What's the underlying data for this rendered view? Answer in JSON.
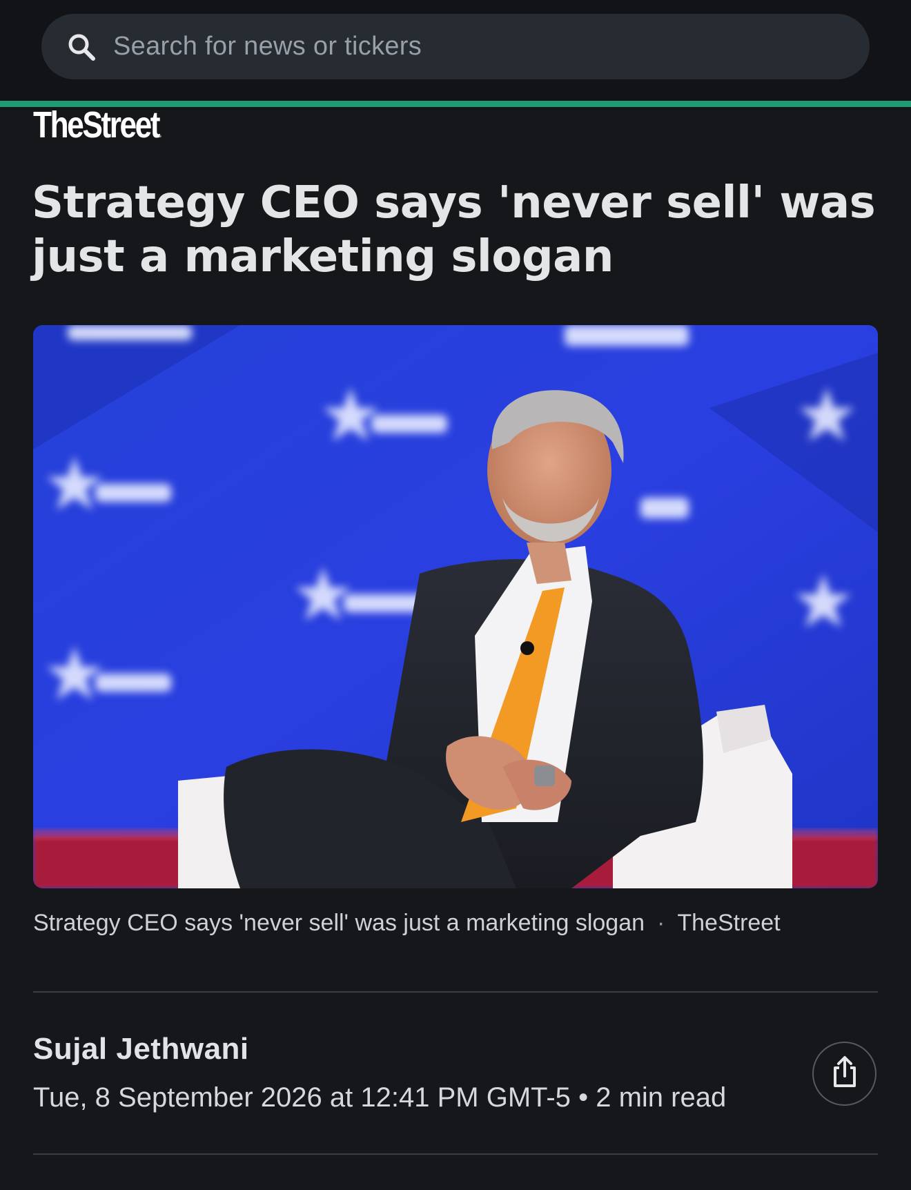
{
  "search": {
    "placeholder": "Search for news or tickers"
  },
  "publisher": {
    "logo_text": "TheStreet"
  },
  "article": {
    "headline": "Strategy CEO says 'never sell' was just a marketing slogan",
    "image_caption": "Strategy CEO says 'never sell' was just a marketing slogan",
    "image_source": "TheStreet",
    "caption_separator": "·",
    "author": "Sujal Jethwani",
    "date": "Tue, 8 September 2026 at 12:41 PM GMT-5",
    "meta_separator": "•",
    "read_time": "2 min read"
  },
  "icons": {
    "search": "search-icon",
    "share": "share-icon"
  },
  "colors": {
    "background": "#15171b",
    "accent_line": "#1f9c72",
    "search_bg": "#272b32"
  }
}
